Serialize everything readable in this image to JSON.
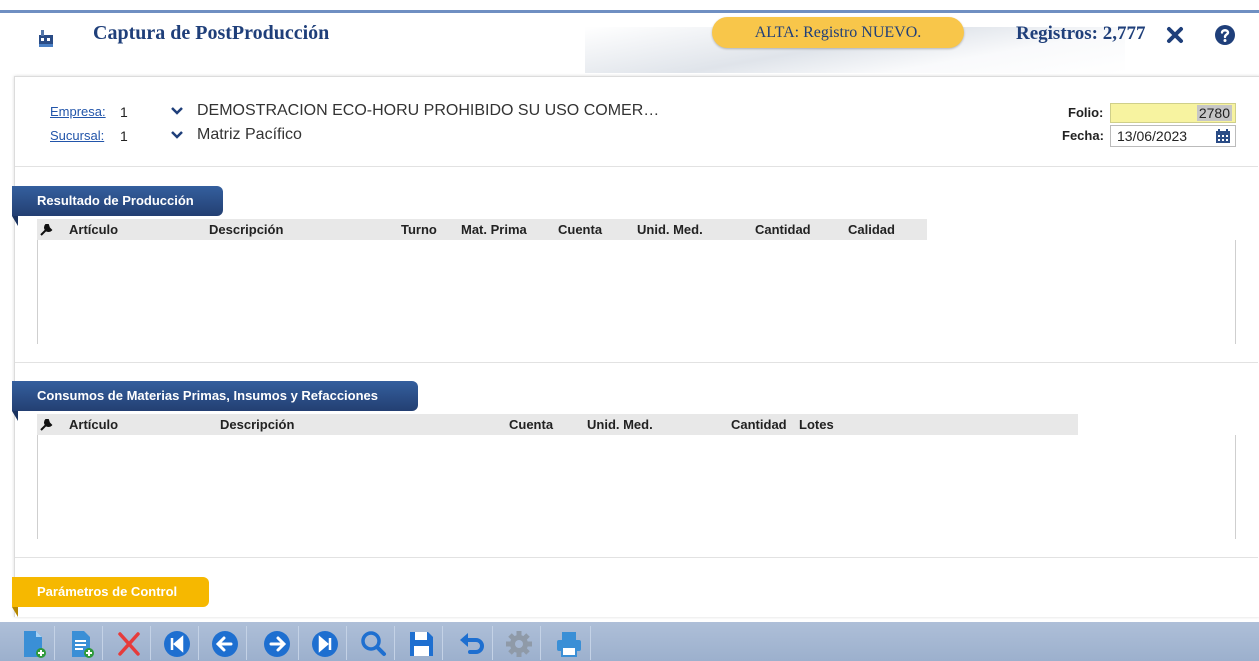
{
  "header": {
    "title": "Captura de PostProducción",
    "status": "ALTA: Registro NUEVO.",
    "records": "Registros: 2,777",
    "icons": [
      "factory-icon",
      "close-icon",
      "help-icon"
    ]
  },
  "form": {
    "empresa": {
      "label": "Empresa:",
      "value": "1",
      "description": "DEMOSTRACION ECO-HORU PROHIBIDO SU USO COMER…"
    },
    "sucursal": {
      "label": "Sucursal:",
      "value": "1",
      "description": "Matriz Pacífico"
    },
    "folio": {
      "label": "Folio:",
      "value": "2780"
    },
    "fecha": {
      "label": "Fecha:",
      "value": "13/06/2023"
    }
  },
  "sections": {
    "produccion": {
      "title": "Resultado de Producción",
      "columns": [
        "Artículo",
        "Descripción",
        "Turno",
        "Mat. Prima",
        "Cuenta",
        "Unid. Med.",
        "Cantidad",
        "Calidad"
      ],
      "rows": []
    },
    "consumos": {
      "title": "Consumos de Materias Primas, Insumos y Refacciones",
      "columns": [
        "Artículo",
        "Descripción",
        "Cuenta",
        "Unid. Med.",
        "Cantidad",
        "Lotes"
      ],
      "rows": []
    },
    "parametros": {
      "title": "Parámetros de Control"
    }
  },
  "toolbar": {
    "buttons": [
      "new-document-icon",
      "new-from-copy-icon",
      "delete-icon",
      "first-record-icon",
      "previous-record-icon",
      "next-record-icon",
      "last-record-icon",
      "search-icon",
      "save-icon",
      "undo-icon",
      "settings-icon",
      "print-icon"
    ]
  },
  "colors": {
    "title": "#1f3f7a",
    "status_pill": "#f8c64a",
    "section_tab_blue": "#2a4c86",
    "section_tab_gold": "#f6b800",
    "folio_bg": "#f7f3a0",
    "toolbar": "#a6b8d3"
  }
}
